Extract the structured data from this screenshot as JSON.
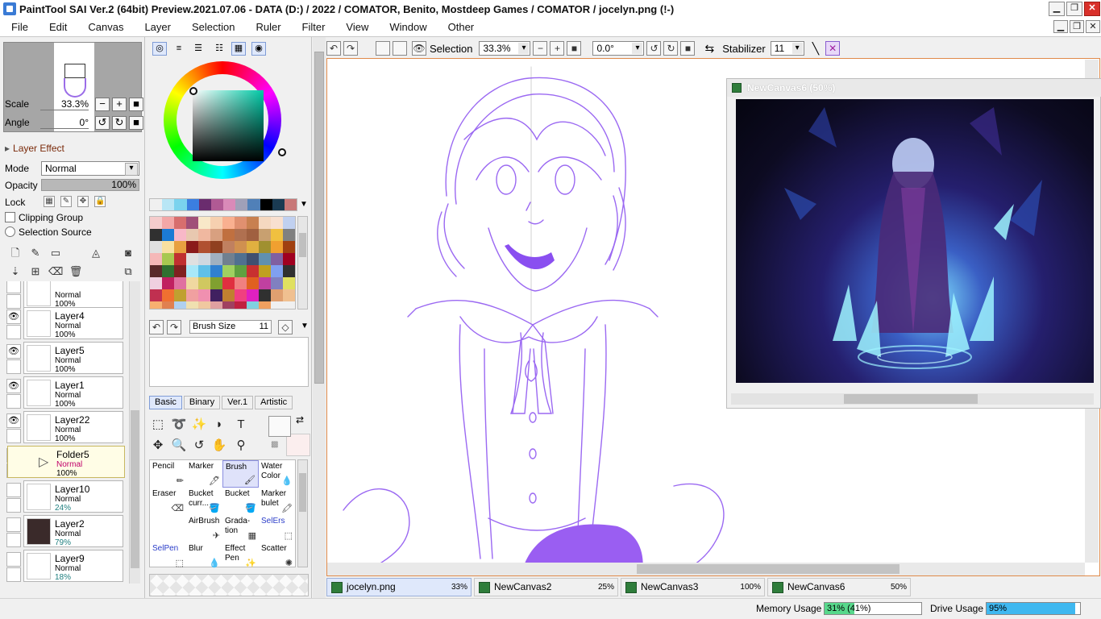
{
  "titlebar": {
    "title": "PaintTool SAI Ver.2 (64bit) Preview.2021.07.06 - DATA (D:) / 2022 / COMATOR, Benito, Mostdeep Games / COMATOR / jocelyn.png (!-)",
    "minimize": "▁",
    "restore": "❐",
    "close": "✕"
  },
  "menu": [
    "File",
    "Edit",
    "Canvas",
    "Layer",
    "Selection",
    "Ruler",
    "Filter",
    "View",
    "Window",
    "Other"
  ],
  "navigator": {
    "scale_label": "Scale",
    "scale_value": "33.3%",
    "angle_label": "Angle",
    "angle_value": "0°"
  },
  "layer_props": {
    "effect_label": "Layer Effect",
    "mode_label": "Mode",
    "mode_value": "Normal",
    "opacity_label": "Opacity",
    "opacity_value": "100%",
    "lock_label": "Lock",
    "clipping_group": "Clipping Group",
    "selection_source": "Selection Source"
  },
  "layers": [
    {
      "name": "",
      "mode": "Normal",
      "opacity": "100%",
      "visible": false
    },
    {
      "name": "Layer4",
      "mode": "Normal",
      "opacity": "100%",
      "visible": true
    },
    {
      "name": "Layer5",
      "mode": "Normal",
      "opacity": "100%",
      "visible": true
    },
    {
      "name": "Layer1",
      "mode": "Normal",
      "opacity": "100%",
      "visible": true
    },
    {
      "name": "Layer22",
      "mode": "Normal",
      "opacity": "100%",
      "visible": true
    },
    {
      "name": "Folder5",
      "mode": "Normal",
      "opacity": "100%",
      "visible": false
    },
    {
      "name": "Layer10",
      "mode": "Normal",
      "opacity": "24%",
      "visible": false
    },
    {
      "name": "Layer2",
      "mode": "Normal",
      "opacity": "79%",
      "visible": false
    },
    {
      "name": "Layer9",
      "mode": "Normal",
      "opacity": "18%",
      "visible": false
    }
  ],
  "color": {
    "mix_colors": [
      "#f0f0f0",
      "#b8e6f5",
      "#7ad3ee",
      "#3b7ee0",
      "#6a2c6e",
      "#b05a94",
      "#d98ab8",
      "#a0a0b8",
      "#5080b8",
      "#000000",
      "#1a3a52",
      "#c87878"
    ],
    "swatches": [
      "#f5cccc",
      "#f3a7a7",
      "#d76e6e",
      "#a04f78",
      "#f8e8c8",
      "#f6d0b0",
      "#f9b090",
      "#e09070",
      "#c88050",
      "#f5d8c0",
      "#f8e0d0",
      "#c0d0f0",
      "#303030",
      "#1b7ad4",
      "#f8b8c8",
      "#e8c8b0",
      "#f0b8a0",
      "#d8a080",
      "#c07040",
      "#b07050",
      "#a06040",
      "#c8a070",
      "#f0c040",
      "#808080",
      "#e0e0e0",
      "#f8e0a0",
      "#e8a040",
      "#8a1a1a",
      "#b05030",
      "#904020",
      "#c08060",
      "#d09050",
      "#e0b040",
      "#a09030",
      "#f0a030",
      "#a04010",
      "#f5b8b8",
      "#a8c850",
      "#c03030",
      "#e0e0e0",
      "#d0d8e0",
      "#a0b0c0",
      "#708090",
      "#507090",
      "#405070",
      "#6090b0",
      "#8060a0",
      "#a00020",
      "#5a2a2a",
      "#307030",
      "#802020",
      "#a8e8f8",
      "#60c0e8",
      "#3080d0",
      "#a0d060",
      "#60a040",
      "#c83030",
      "#c0a020",
      "#80a0f0",
      "#303030",
      "#f0d0e0",
      "#c02060",
      "#e070a0",
      "#f0d8a0",
      "#d0c860",
      "#80a030",
      "#e03040",
      "#f08080",
      "#e06020",
      "#c040a0",
      "#8080c0",
      "#e0e060",
      "#c03050",
      "#f07030",
      "#c0a030",
      "#f0a0a0",
      "#f090b0",
      "#402060",
      "#c08030",
      "#f04080",
      "#e020c0",
      "#303030",
      "#e0a070",
      "#f0c090",
      "#f8b070",
      "#e08050",
      "#b0d0f0",
      "#f0e0b0",
      "#f0c8a0",
      "#e0a0a0",
      "#a04060",
      "#c02040",
      "#80d0e0",
      "#f0a060"
    ],
    "brush_size_label": "Brush Size",
    "brush_size_value": "11"
  },
  "tool_tabs": [
    "Basic",
    "Binary",
    "Ver.1",
    "Artistic"
  ],
  "tools": [
    {
      "name": "Pencil",
      "active": false
    },
    {
      "name": "Marker",
      "active": false
    },
    {
      "name": "Brush",
      "active": true
    },
    {
      "name": "Water Color",
      "active": false
    },
    {
      "name": "Eraser",
      "active": false
    },
    {
      "name": "Bucket curr...",
      "active": false
    },
    {
      "name": "Bucket",
      "active": false
    },
    {
      "name": "Marker bulet",
      "active": false
    },
    {
      "name": "",
      "active": false
    },
    {
      "name": "AirBrush",
      "active": false
    },
    {
      "name": "Grada-tion",
      "active": false
    },
    {
      "name": "SelErs",
      "active": false
    },
    {
      "name": "SelPen",
      "active": false
    },
    {
      "name": "Blur",
      "active": false
    },
    {
      "name": "Effect Pen",
      "active": false
    },
    {
      "name": "Scatter",
      "active": false
    }
  ],
  "canvas_toolbar": {
    "selection_label": "Selection",
    "zoom_value": "33.3%",
    "angle_value": "0.0°",
    "stabilizer_label": "Stabilizer",
    "stabilizer_value": "11"
  },
  "subwindow": {
    "title": "NewCanvas6 (50%)"
  },
  "doc_tabs": [
    {
      "name": "jocelyn.png",
      "zoom": "33%",
      "active": true
    },
    {
      "name": "NewCanvas2",
      "zoom": "25%",
      "active": false
    },
    {
      "name": "NewCanvas3",
      "zoom": "100%",
      "active": false
    },
    {
      "name": "NewCanvas6",
      "zoom": "50%",
      "active": false
    }
  ],
  "status": {
    "memory_label": "Memory Usage",
    "memory_value": "31% (41%)",
    "memory_fraction": 0.31,
    "drive_label": "Drive Usage",
    "drive_value": "95%",
    "drive_fraction": 0.95,
    "memory_color": "#57d88b",
    "drive_color": "#3fb8f0"
  },
  "colors": {
    "accent": "#8a4ff0",
    "selection_highlight": "#dfe8fb",
    "canvas_border": "#e08a4a"
  }
}
